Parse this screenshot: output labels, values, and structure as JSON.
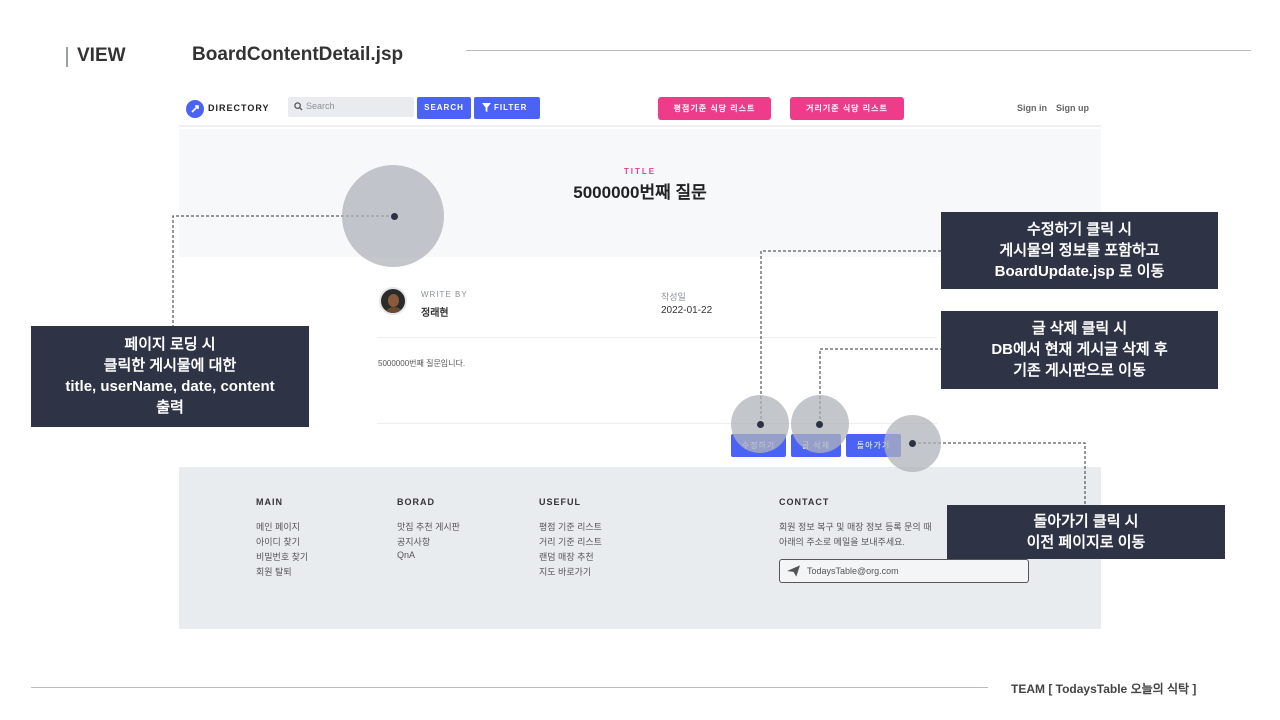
{
  "slide": {
    "view_label": "VIEW",
    "file_label": "BoardContentDetail.jsp",
    "footer_team": "TEAM [ TodaysTable 오늘의 식탁 ]"
  },
  "nav": {
    "logo_text": "DIRECTORY",
    "search_placeholder": "Search",
    "search_button": "SEARCH",
    "filter_button": "FILTER",
    "rating_list_button": "평점기준 식당 리스트",
    "distance_list_button": "거리기준 식당 리스트",
    "signin": "Sign in",
    "signup": "Sign up"
  },
  "post": {
    "title_label": "TITLE",
    "title": "5000000번째 질문",
    "write_by_label": "WRITE BY",
    "author": "정래현",
    "date_label": "작성일",
    "date": "2022-01-22",
    "content": "5000000번째 질문입니다."
  },
  "actions": {
    "edit": "수정하기",
    "delete": "글 삭제",
    "back": "돌아가기"
  },
  "footer": {
    "main": {
      "title": "MAIN",
      "items": [
        "메인 페이지",
        "아이디 찾기",
        "비밀번호 찾기",
        "회원 탈퇴"
      ]
    },
    "borad": {
      "title": "BORAD",
      "items": [
        "맛집 추천 게시판",
        "공지사항",
        "QnA"
      ]
    },
    "useful": {
      "title": "USEFUL",
      "items": [
        "평점 기준 리스트",
        "거리 기준 리스트",
        "랜덤 매장 추천",
        "지도 바로가기"
      ]
    },
    "contact": {
      "title": "CONTACT",
      "lines": [
        "회원 정보 복구 및 매장 정보 등록 문의 때",
        "아래의 주소로 메일을 보내주세요."
      ],
      "email": "TodaysTable@org.com"
    }
  },
  "callouts": {
    "load": [
      "페이지 로딩 시",
      "클릭한 게시물에 대한",
      "title, userName, date, content",
      "출력"
    ],
    "edit": [
      "수정하기 클릭 시",
      "게시물의 정보를 포함하고",
      "BoardUpdate.jsp 로 이동"
    ],
    "delete": [
      "글 삭제 클릭 시",
      "DB에서 현재 게시글 삭제 후",
      "기존 게시판으로 이동"
    ],
    "back": [
      "돌아가기 클릭 시",
      "이전 페이지로 이동"
    ]
  },
  "colors": {
    "accent_blue": "#4b63f5",
    "accent_pink": "#ee3b8a",
    "callout_bg": "#2e3446"
  }
}
